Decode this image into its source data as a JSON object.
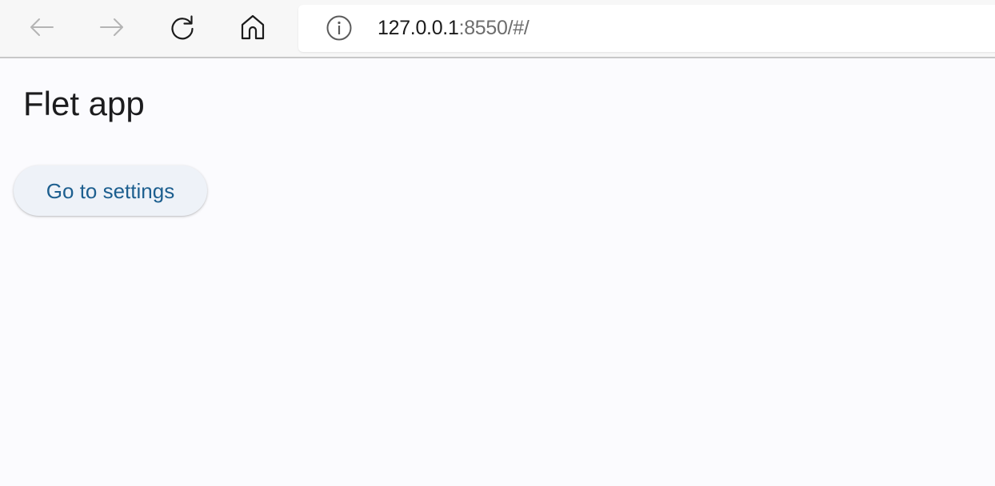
{
  "browser": {
    "url_host": "127.0.0.1",
    "url_rest": ":8550/#/",
    "icons": {
      "back": "arrow-left-icon",
      "forward": "arrow-right-icon",
      "reload": "reload-icon",
      "home": "home-icon",
      "info": "info-icon"
    }
  },
  "app": {
    "title": "Flet app",
    "settings_button_label": "Go to settings"
  },
  "colors": {
    "page_background": "#fbfbfe",
    "button_text": "#1d5f8f",
    "button_background": "#eef2f8"
  }
}
